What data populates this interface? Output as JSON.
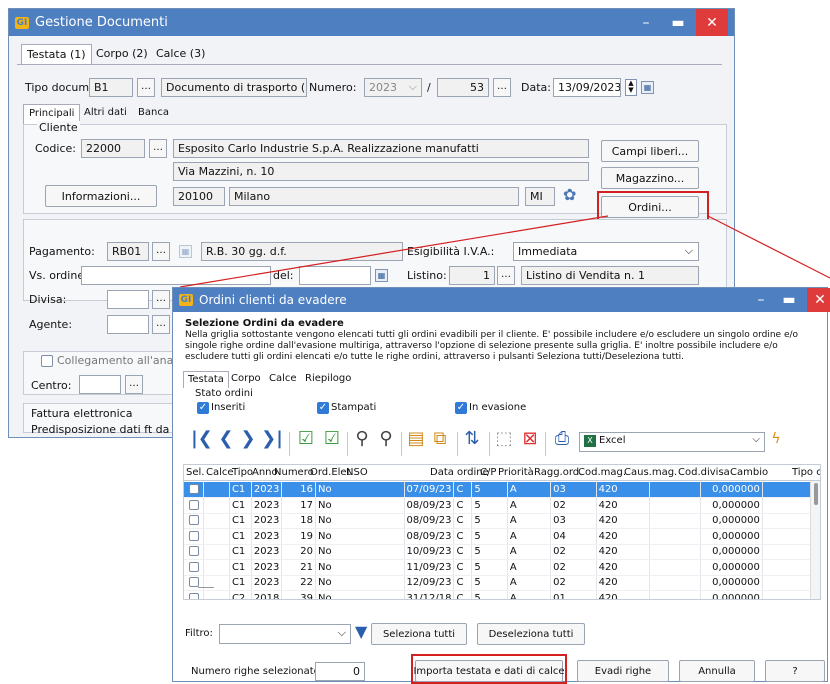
{
  "main_window": {
    "title": "Gestione Documenti",
    "app_icon": "GI",
    "tabs": [
      "Testata (1)",
      "Corpo (2)",
      "Calce (3)"
    ],
    "tipo_docum_label": "Tipo docum.:",
    "tipo_docum_value": "B1",
    "tipo_docum_desc": "Documento di trasporto (DI",
    "numero_label": "Numero:",
    "numero_year": "2023",
    "numero_sep": "/",
    "numero_value": "53",
    "data_label": "Data:",
    "data_value": "13/09/2023",
    "subtabs": [
      "Principali",
      "Altri dati",
      "Banca"
    ],
    "cliente_group": "Cliente",
    "codice_label": "Codice:",
    "codice_value": "22000",
    "ragione_sociale": "Esposito Carlo Industrie S.p.A. Realizzazione manufatti",
    "indirizzo": "Via Mazzini, n. 10",
    "cap": "20100",
    "citta": "Milano",
    "provincia": "MI",
    "informazioni_button": "Informazioni...",
    "campi_liberi_button": "Campi liberi...",
    "magazzino_button": "Magazzino...",
    "ordini_button": "Ordini...",
    "pagamento_label": "Pagamento:",
    "pagamento_code": "RB01",
    "pagamento_desc": "R.B. 30 gg. d.f.",
    "esigibilita_label": "Esigibilità I.V.A.:",
    "esigibilita_value": "Immediata",
    "vs_ordine_label": "Vs. ordine:",
    "del_label": "del:",
    "listino_label": "Listino:",
    "listino_num": "1",
    "listino_desc": "Listino di Vendita n. 1",
    "divisa_label": "Divisa:",
    "agente_label": "Agente:",
    "collegamento_label": "Collegamento all'analiti",
    "centro_label": "Centro:",
    "fattura_label": "Fattura elettronica",
    "predisposizione_label": "Predisposizione dati ft da"
  },
  "dialog": {
    "title": "Ordini clienti da evadere",
    "heading": "Selezione Ordini da evadere",
    "description": "Nella griglia sottostante vengono elencati tutti gli ordini evadibili per il cliente. E' possibile includere e/o escludere un singolo ordine e/o singole righe ordine dall'evasione multiriga, attraverso l'opzione di selezione presente sulla griglia. E' inoltre possibile includere e/o escludere tutti gli ordini elencati e/o tutte le righe ordini, attraverso i pulsanti Seleziona tutti/Deseleziona tutti.",
    "tabs": [
      "Testata",
      "Corpo",
      "Calce",
      "Riepilogo"
    ],
    "stato_group": "Stato ordini",
    "stato_options": [
      "Inseriti",
      "Stampati",
      "In evasione"
    ],
    "export_select": "Excel",
    "columns": [
      "Sel.",
      "Calce",
      "Tipo",
      "Anno",
      "Numero",
      "Ord.Elet.",
      "NSO",
      "Data ordine",
      "C/P",
      "Priorità",
      "Ragg.ord.",
      "Cod.mag.",
      "Caus.mag.",
      "Cod.divisa",
      "Cambio",
      "Tipo c"
    ],
    "rows": [
      {
        "tipo": "C1",
        "anno": "2023",
        "numero": "16",
        "ord_elet": "No",
        "data": "07/09/23",
        "cp": "C",
        "priorita": "5",
        "ragg": "A",
        "codmag": "03",
        "causmag": "420",
        "cambio": "0,000000"
      },
      {
        "tipo": "C1",
        "anno": "2023",
        "numero": "17",
        "ord_elet": "No",
        "data": "08/09/23",
        "cp": "C",
        "priorita": "5",
        "ragg": "A",
        "codmag": "02",
        "causmag": "420",
        "cambio": "0,000000"
      },
      {
        "tipo": "C1",
        "anno": "2023",
        "numero": "18",
        "ord_elet": "No",
        "data": "08/09/23",
        "cp": "C",
        "priorita": "5",
        "ragg": "A",
        "codmag": "03",
        "causmag": "420",
        "cambio": "0,000000"
      },
      {
        "tipo": "C1",
        "anno": "2023",
        "numero": "19",
        "ord_elet": "No",
        "data": "08/09/23",
        "cp": "C",
        "priorita": "5",
        "ragg": "A",
        "codmag": "04",
        "causmag": "420",
        "cambio": "0,000000"
      },
      {
        "tipo": "C1",
        "anno": "2023",
        "numero": "20",
        "ord_elet": "No",
        "data": "10/09/23",
        "cp": "C",
        "priorita": "5",
        "ragg": "A",
        "codmag": "02",
        "causmag": "420",
        "cambio": "0,000000"
      },
      {
        "tipo": "C1",
        "anno": "2023",
        "numero": "21",
        "ord_elet": "No",
        "data": "11/09/23",
        "cp": "C",
        "priorita": "5",
        "ragg": "A",
        "codmag": "02",
        "causmag": "420",
        "cambio": "0,000000"
      },
      {
        "tipo": "C1",
        "anno": "2023",
        "numero": "22",
        "ord_elet": "No",
        "data": "12/09/23",
        "cp": "C",
        "priorita": "5",
        "ragg": "A",
        "codmag": "02",
        "causmag": "420",
        "cambio": "0,000000"
      },
      {
        "tipo": "C2",
        "anno": "2018",
        "numero": "39",
        "ord_elet": "No",
        "data": "31/12/18",
        "cp": "C",
        "priorita": "5",
        "ragg": "A",
        "codmag": "01",
        "causmag": "420",
        "cambio": "0,000000"
      }
    ],
    "filtro_label": "Filtro:",
    "seleziona_tutti": "Seleziona tutti",
    "deseleziona_tutti": "Deseleziona tutti",
    "numero_righe_label": "Numero righe selezionate:",
    "numero_righe_value": "0",
    "importa_button": "Importa testata e dati di calce",
    "evadi_button": "Evadi righe",
    "annulla_button": "Annulla",
    "help_button": "?"
  },
  "colors": {
    "titlebar": "#4d7fc1",
    "highlight": "#d42020",
    "selected_row": "#3a8fe8"
  }
}
